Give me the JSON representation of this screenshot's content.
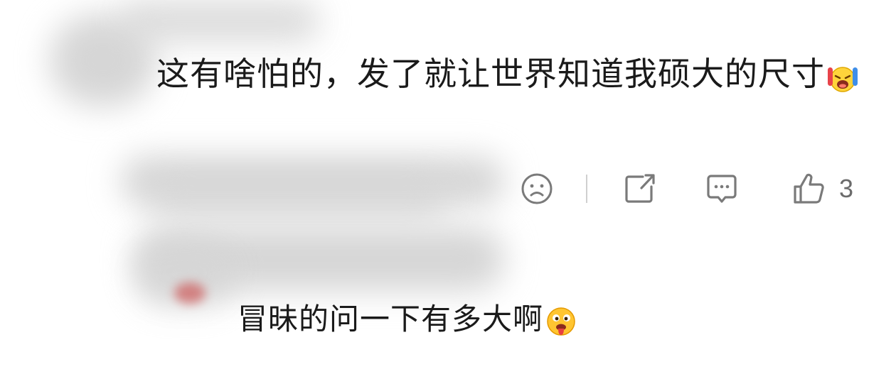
{
  "comment": {
    "text": "这有啥怕的，发了就让世界知道我硕大的尺寸",
    "emoji": "crying-laughing-emoji",
    "actions": {
      "like_count": "3"
    }
  },
  "reply": {
    "text": "冒昧的问一下有多大啊",
    "emoji": "drooling-emoji"
  },
  "colors": {
    "text": "#1a1a1a",
    "icon": "#7a7a7a",
    "divider": "#d0d0d0"
  }
}
